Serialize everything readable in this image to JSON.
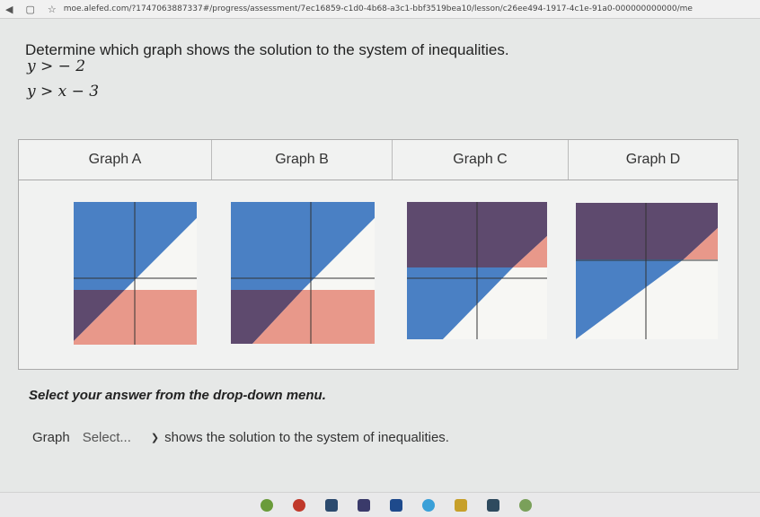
{
  "browser": {
    "url": "moe.alefed.com/?1747063887337#/progress/assessment/7ec16859-c1d0-4b68-a3c1-bbf3519bea10/lesson/c26ee494-1917-4c1e-91a0-000000000000/me"
  },
  "question": {
    "prompt": "Determine which graph shows the solution to the system of inequalities.",
    "inequality_1": "y > − 2",
    "inequality_2": "y > x − 3"
  },
  "graphs": {
    "headers": [
      "Graph A",
      "Graph B",
      "Graph C",
      "Graph D"
    ]
  },
  "answer": {
    "instruction": "Select your answer from the drop-down menu.",
    "prefix": "Graph",
    "dropdown_value": "Select...",
    "suffix": "shows the solution to the system of inequalities."
  },
  "colors": {
    "blue": "#4a80c4",
    "pink": "#e8988a",
    "purple": "#5e4a6e",
    "white": "#f7f7f4"
  }
}
